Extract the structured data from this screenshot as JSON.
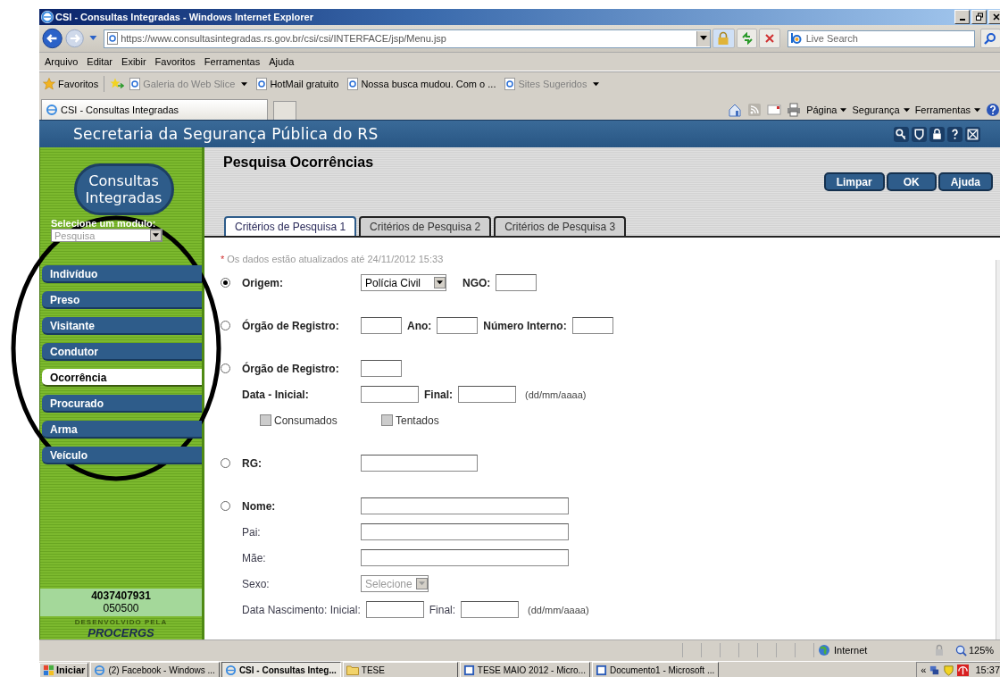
{
  "window": {
    "title": "CSI - Consultas Integradas - Windows Internet Explorer"
  },
  "address_bar": {
    "url": "https://www.consultasintegradas.rs.gov.br/csi/csi/INTERFACE/jsp/Menu.jsp"
  },
  "search": {
    "placeholder": "Live Search"
  },
  "menu": [
    "Arquivo",
    "Editar",
    "Exibir",
    "Favoritos",
    "Ferramentas",
    "Ajuda"
  ],
  "favorites_bar": {
    "label": "Favoritos",
    "links": [
      {
        "label": "Galeria do Web Slice",
        "disabled": true,
        "dropdown": true
      },
      {
        "label": "HotMail gratuito",
        "disabled": false,
        "dropdown": false
      },
      {
        "label": "Nossa busca mudou. Com o ...",
        "disabled": false,
        "dropdown": false
      },
      {
        "label": "Sites Sugeridos",
        "disabled": true,
        "dropdown": true
      }
    ]
  },
  "browser_tab": {
    "title": "CSI - Consultas Integradas"
  },
  "command_bar": [
    "Página",
    "Segurança",
    "Ferramentas"
  ],
  "banner": {
    "title": "Secretaria da Segurança Pública do RS"
  },
  "sidebar": {
    "logo": "Consultas Integradas",
    "module_label": "Selecione um modulo:",
    "module_select": "Pesquisa",
    "items": [
      {
        "label": "Indivíduo",
        "selected": false
      },
      {
        "label": "Preso",
        "selected": false
      },
      {
        "label": "Visitante",
        "selected": false
      },
      {
        "label": "Condutor",
        "selected": false
      },
      {
        "label": "Ocorrência",
        "selected": true
      },
      {
        "label": "Procurado",
        "selected": false
      },
      {
        "label": "Arma",
        "selected": false
      },
      {
        "label": "Veículo",
        "selected": false
      }
    ],
    "user_id": "4037407931",
    "user_code": "050500",
    "credit": "DESENVOLVIDO PELA",
    "brand": "PROCERGS"
  },
  "page": {
    "title": "Pesquisa Ocorrências",
    "buttons": [
      "Limpar",
      "OK",
      "Ajuda"
    ],
    "tabs": [
      {
        "label": "Critérios de Pesquisa 1",
        "selected": true
      },
      {
        "label": "Critérios de Pesquisa 2",
        "selected": false
      },
      {
        "label": "Critérios de Pesquisa 3",
        "selected": false
      }
    ],
    "notice_mark": "*",
    "notice": "Os dados estão atualizados até 24/11/2012 15:33",
    "groups": [
      {
        "selected": true,
        "rows": [
          [
            {
              "kind": "label",
              "text": "Origem:",
              "bold": true
            },
            {
              "kind": "select",
              "value": "Polícia Civil",
              "disabled": false
            },
            {
              "kind": "label",
              "text": "NGO:",
              "bold": true
            },
            {
              "kind": "input"
            }
          ]
        ]
      },
      {
        "selected": false,
        "rows": [
          [
            {
              "kind": "label",
              "text": "Órgão de Registro:",
              "bold": true
            },
            {
              "kind": "input"
            },
            {
              "kind": "label",
              "text": "Ano:",
              "bold": true
            },
            {
              "kind": "input"
            },
            {
              "kind": "label",
              "text": "Número Interno:",
              "bold": true
            },
            {
              "kind": "input"
            }
          ]
        ]
      },
      {
        "selected": false,
        "rows": [
          [
            {
              "kind": "label",
              "text": "Órgão de Registro:",
              "bold": true
            },
            {
              "kind": "input"
            }
          ],
          [
            {
              "kind": "label",
              "text": "Data  -  Inicial:",
              "bold": true
            },
            {
              "kind": "input"
            },
            {
              "kind": "label",
              "text": "Final:",
              "bold": true
            },
            {
              "kind": "input"
            },
            {
              "kind": "hint",
              "text": "(dd/mm/aaaa)"
            }
          ],
          [
            {
              "kind": "checkbox",
              "text": "Consumados",
              "checked": false,
              "disabled": true
            },
            {
              "kind": "checkbox",
              "text": "Tentados",
              "checked": false,
              "disabled": true
            }
          ]
        ]
      },
      {
        "selected": false,
        "rows": [
          [
            {
              "kind": "label",
              "text": "RG:",
              "bold": true
            },
            {
              "kind": "input"
            }
          ]
        ]
      },
      {
        "selected": false,
        "rows": [
          [
            {
              "kind": "label",
              "text": "Nome:",
              "bold": true
            },
            {
              "kind": "input"
            }
          ],
          [
            {
              "kind": "label",
              "text": "Pai:",
              "bold": false
            },
            {
              "kind": "input"
            }
          ],
          [
            {
              "kind": "label",
              "text": "Mãe:",
              "bold": false
            },
            {
              "kind": "input"
            }
          ],
          [
            {
              "kind": "label",
              "text": "Sexo:",
              "bold": false
            },
            {
              "kind": "select",
              "value": "Selecione",
              "disabled": true
            }
          ],
          [
            {
              "kind": "label",
              "text": "Data Nascimento: Inicial:",
              "bold": false
            },
            {
              "kind": "input"
            },
            {
              "kind": "label",
              "text": "Final:",
              "bold": false
            },
            {
              "kind": "input"
            },
            {
              "kind": "hint",
              "text": "(dd/mm/aaaa)"
            }
          ]
        ]
      }
    ]
  },
  "status_bar": {
    "zone": "Internet",
    "zoom": "125%"
  },
  "taskbar": {
    "start": "Iniciar",
    "items": [
      {
        "label": "(2) Facebook - Windows ...",
        "selected": false,
        "kind": "browser"
      },
      {
        "label": "CSI - Consultas Integ...",
        "selected": true,
        "kind": "browser"
      },
      {
        "label": "TESE",
        "selected": false,
        "kind": "folder"
      },
      {
        "label": "TESE MAIO 2012 - Micro...",
        "selected": false,
        "kind": "document"
      },
      {
        "label": "Documento1 - Microsoft ...",
        "selected": false,
        "kind": "document"
      }
    ],
    "tray_toggle": "«",
    "clock": "15:37"
  }
}
